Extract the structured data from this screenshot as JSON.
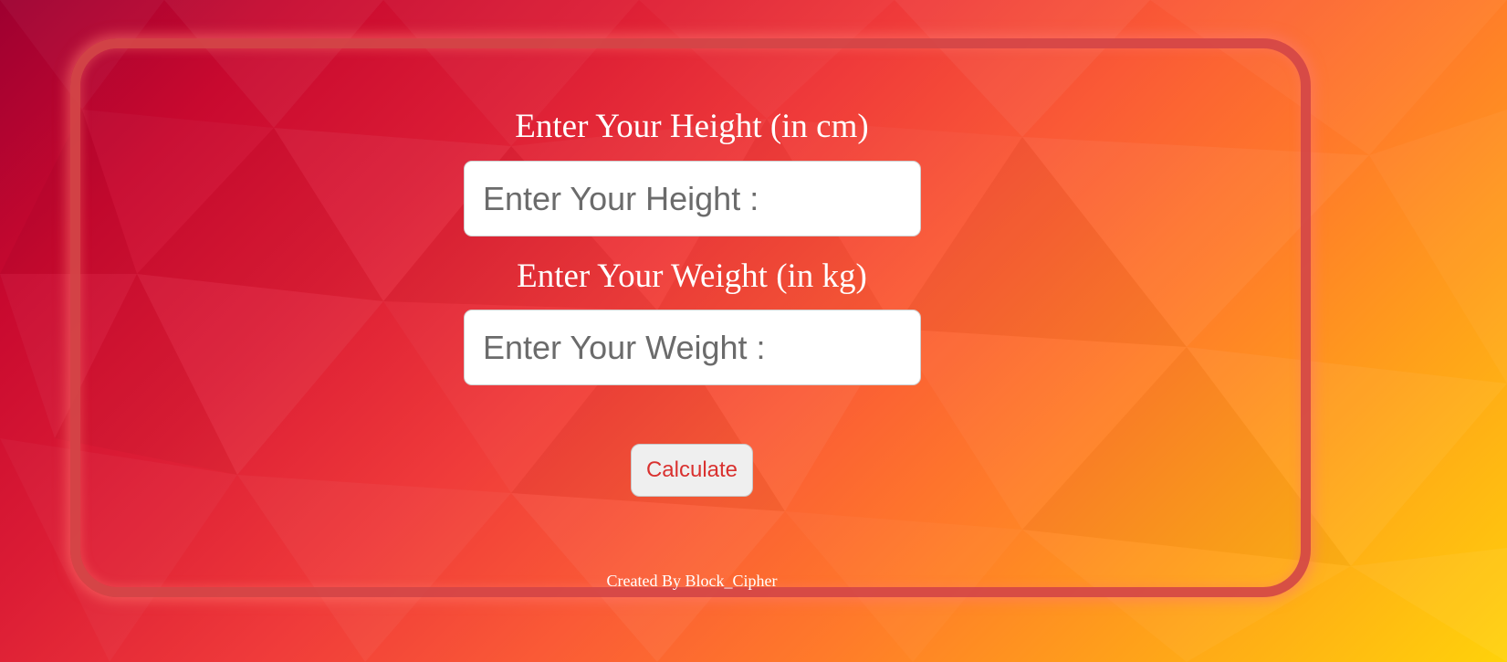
{
  "form": {
    "height_label": "Enter Your Height (in cm)",
    "height_placeholder": "Enter Your Height :",
    "height_value": "",
    "weight_label": "Enter Your Weight (in kg)",
    "weight_placeholder": "Enter Your Weight :",
    "weight_value": "",
    "calculate_label": "Calculate"
  },
  "footer": {
    "credit": "Created By Block_Cipher"
  },
  "colors": {
    "card_border": "#d44648",
    "button_text": "#d9312f",
    "label_text": "#ffffff"
  }
}
